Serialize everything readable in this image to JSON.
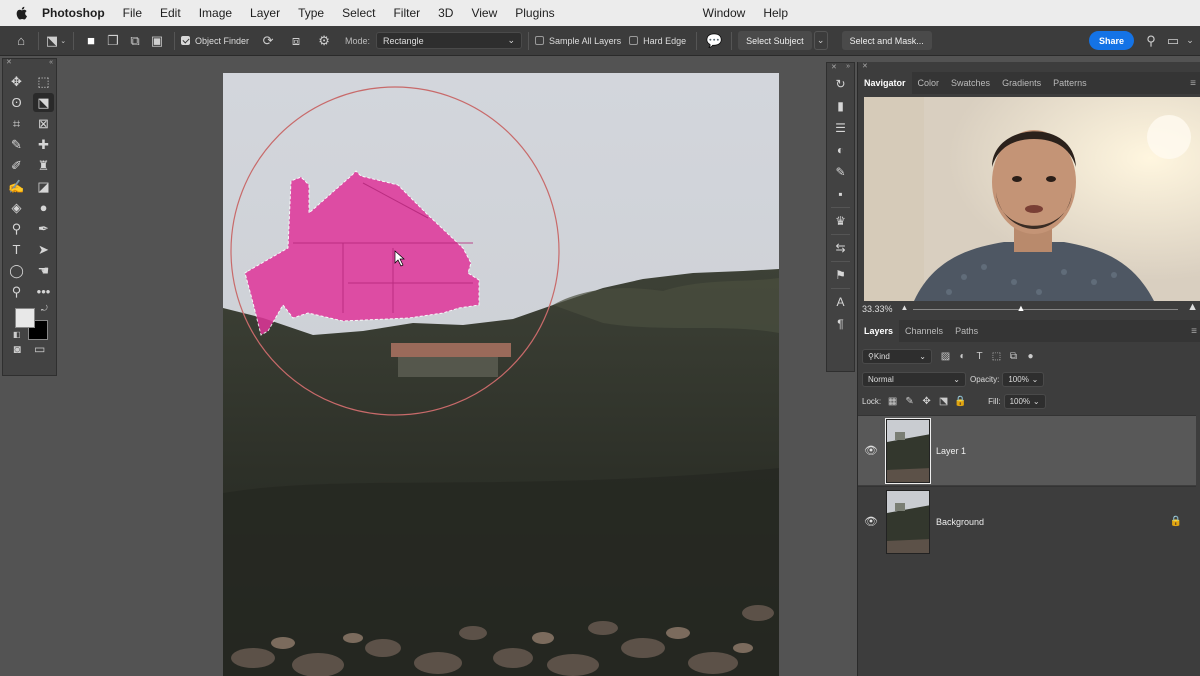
{
  "menubar": {
    "app_name": "Photoshop",
    "items": [
      "File",
      "Edit",
      "Image",
      "Layer",
      "Type",
      "Select",
      "Filter",
      "3D",
      "View",
      "Plugins"
    ],
    "right_items": [
      "Window",
      "Help"
    ]
  },
  "options_bar": {
    "object_finder_label": "Object Finder",
    "object_finder_checked": true,
    "mode_label": "Mode:",
    "mode_value": "Rectangle",
    "sample_all_layers_label": "Sample All Layers",
    "sample_all_layers_checked": false,
    "hard_edge_label": "Hard Edge",
    "hard_edge_checked": false,
    "select_subject_label": "Select Subject",
    "select_and_mask_label": "Select and Mask...",
    "share_label": "Share"
  },
  "tools": {
    "items": [
      {
        "name": "move-tool-icon",
        "glyph": "✥",
        "selected": false
      },
      {
        "name": "marquee-tool-icon",
        "glyph": "⬚",
        "selected": false
      },
      {
        "name": "lasso-tool-icon",
        "glyph": "ʘ",
        "selected": false
      },
      {
        "name": "object-selection-tool-icon",
        "glyph": "⬔",
        "selected": true
      },
      {
        "name": "crop-tool-icon",
        "glyph": "⌗",
        "selected": false
      },
      {
        "name": "frame-tool-icon",
        "glyph": "⊠",
        "selected": false
      },
      {
        "name": "eyedropper-tool-icon",
        "glyph": "✎",
        "selected": false
      },
      {
        "name": "healing-brush-tool-icon",
        "glyph": "✚",
        "selected": false
      },
      {
        "name": "brush-tool-icon",
        "glyph": "✐",
        "selected": false
      },
      {
        "name": "clone-stamp-tool-icon",
        "glyph": "♜",
        "selected": false
      },
      {
        "name": "history-brush-tool-icon",
        "glyph": "✍",
        "selected": false
      },
      {
        "name": "eraser-tool-icon",
        "glyph": "◪",
        "selected": false
      },
      {
        "name": "paint-bucket-tool-icon",
        "glyph": "◈",
        "selected": false
      },
      {
        "name": "blur-tool-icon",
        "glyph": "●",
        "selected": false
      },
      {
        "name": "dodge-tool-icon",
        "glyph": "⚲",
        "selected": false
      },
      {
        "name": "pen-tool-icon",
        "glyph": "✒",
        "selected": false
      },
      {
        "name": "type-tool-icon",
        "glyph": "T",
        "selected": false
      },
      {
        "name": "path-selection-tool-icon",
        "glyph": "➤",
        "selected": false
      },
      {
        "name": "ellipse-tool-icon",
        "glyph": "◯",
        "selected": false
      },
      {
        "name": "hand-tool-icon",
        "glyph": "☚",
        "selected": false
      },
      {
        "name": "zoom-tool-icon",
        "glyph": "⚲",
        "selected": false
      },
      {
        "name": "more-tools-icon",
        "glyph": "•••",
        "selected": false
      }
    ]
  },
  "navigator": {
    "tabs": [
      "Navigator",
      "Color",
      "Swatches",
      "Gradients",
      "Patterns"
    ],
    "active_tab": "Navigator",
    "zoom": "33.33%"
  },
  "layers_panel": {
    "tabs": [
      "Layers",
      "Channels",
      "Paths"
    ],
    "active_tab": "Layers",
    "filter_kind": "Kind",
    "blend_mode": "Normal",
    "opacity_label": "Opacity:",
    "opacity_value": "100%",
    "lock_label": "Lock:",
    "fill_label": "Fill:",
    "fill_value": "100%",
    "layers": [
      {
        "name": "Layer 1",
        "selected": true,
        "locked": false,
        "visible": true
      },
      {
        "name": "Background",
        "selected": false,
        "locked": true,
        "visible": true
      }
    ]
  },
  "colors": {
    "selection_overlay": "#e0359a",
    "accent": "#1473e6",
    "panel_bg": "#3d3d3d",
    "app_bg": "#535353"
  }
}
